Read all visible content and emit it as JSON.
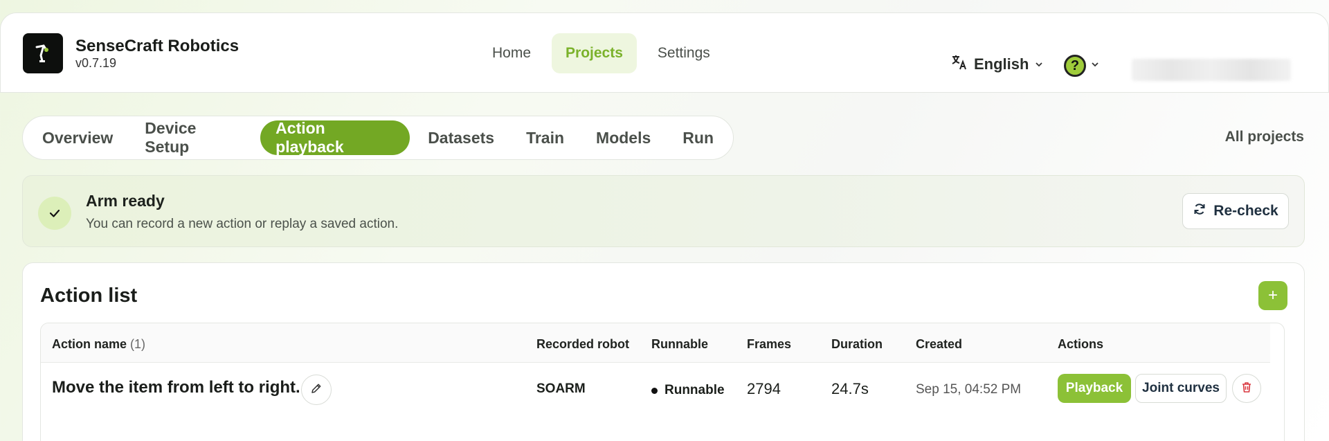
{
  "brand": {
    "name": "SenseCraft Robotics",
    "version": "v0.7.19"
  },
  "nav": [
    {
      "label": "Home",
      "active": false
    },
    {
      "label": "Projects",
      "active": true
    },
    {
      "label": "Settings",
      "active": false
    }
  ],
  "language": {
    "label": "English",
    "icon": "translate-icon"
  },
  "help": {
    "icon": "help-icon",
    "glyph": "?"
  },
  "tabs": [
    {
      "label": "Overview",
      "active": false
    },
    {
      "label": "Device Setup",
      "active": false
    },
    {
      "label": "Action playback",
      "active": true
    },
    {
      "label": "Datasets",
      "active": false
    },
    {
      "label": "Train",
      "active": false
    },
    {
      "label": "Models",
      "active": false
    },
    {
      "label": "Run",
      "active": false
    }
  ],
  "all_projects_label": "All projects",
  "banner": {
    "title": "Arm ready",
    "subtitle": "You can record a new action or replay a saved action.",
    "recheck_label": "Re-check"
  },
  "action_list": {
    "title": "Action list",
    "add_glyph": "+",
    "columns": {
      "name": "Action name",
      "count": "(1)",
      "robot": "Recorded robot",
      "runnable": "Runnable",
      "frames": "Frames",
      "duration": "Duration",
      "created": "Created",
      "actions": "Actions"
    },
    "rows": [
      {
        "name": "Move the item from left to right.",
        "robot": "SOARM",
        "runnable": "Runnable",
        "frames": "2794",
        "duration": "24.7s",
        "created": "Sep 15, 04:52 PM",
        "playback_label": "Playback",
        "joint_curves_label": "Joint curves"
      }
    ]
  },
  "colors": {
    "accent": "#8cc137",
    "accent_dark": "#73a824",
    "danger": "#d9363e"
  }
}
